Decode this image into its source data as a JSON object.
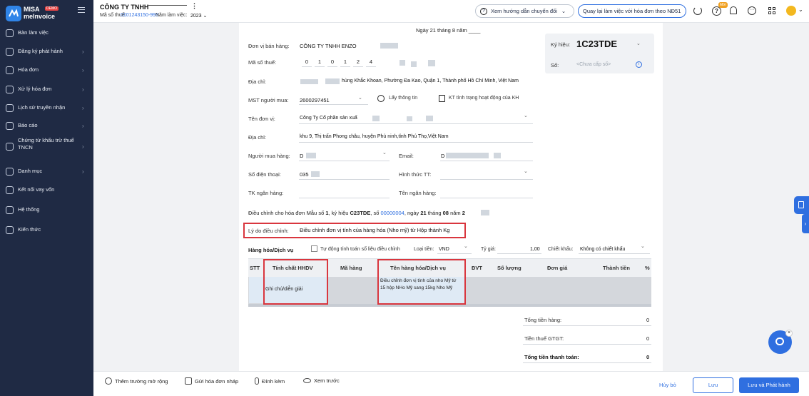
{
  "brand": {
    "line1": "MISA",
    "line2": "meInvoice",
    "badge": "DEMO"
  },
  "sidebar": {
    "items": [
      {
        "label": "Bàn làm việc",
        "icon": "desktop-icon",
        "chev": false
      },
      {
        "label": "Đăng ký phát hành",
        "icon": "register-icon",
        "chev": true
      },
      {
        "label": "Hóa đơn",
        "icon": "invoice-icon",
        "chev": true
      },
      {
        "label": "Xử lý hóa đơn",
        "icon": "process-icon",
        "chev": true
      },
      {
        "label": "Lịch sử truyền nhận",
        "icon": "transfer-icon",
        "chev": true
      },
      {
        "label": "Báo cáo",
        "icon": "report-icon",
        "chev": true
      },
      {
        "label": "Chứng từ khấu trừ thuế TNCN",
        "icon": "tax-doc-icon",
        "chev": true
      },
      {
        "label": "Danh mục",
        "icon": "catalog-icon",
        "chev": true
      },
      {
        "label": "Kết nối vay vốn",
        "icon": "loan-icon",
        "chev": false
      },
      {
        "label": "Hệ thống",
        "icon": "settings-icon",
        "chev": false
      },
      {
        "label": "Kiến thức",
        "icon": "bulb-icon",
        "chev": false
      }
    ]
  },
  "header": {
    "company": "CÔNG TY TNHH",
    "tax_label": "Mã số thuế:",
    "tax_value": "0101243150-996",
    "year_label": "Năm làm việc:",
    "year_value": "2023",
    "guide_btn": "Xem hướng dẫn chuyển đổi",
    "back_btn": "Quay lại làm việc với hóa đơn theo NĐ51",
    "new_badge": "Mới"
  },
  "invoice": {
    "date": "Ngày 21 tháng 8 năm ____",
    "symbol_label": "Ký hiệu:",
    "symbol_value": "1C23TDE",
    "number_label": "Số:",
    "number_placeholder": "<Chưa cấp số>",
    "seller_label": "Đơn vị bán hàng:",
    "seller_value": "CÔNG TY TNHH ENZO",
    "tax_label": "Mã số thuế:",
    "tax_digits": [
      "0",
      "1",
      "0",
      "1",
      "2",
      "4"
    ],
    "address_label": "Địa chỉ:",
    "address_value": "hùng Khắc Khoan, Phường Đa Kao, Quận 1, Thành phố Hồ Chí Minh, Việt Nam",
    "buyer_tax_label": "MST người mua:",
    "buyer_tax_value": "2600297451",
    "lookup_btn": "Lấy thông tin",
    "check_btn": "KT tình trạng hoạt động của KH",
    "unit_label": "Tên đơn vị:",
    "unit_value": "Công Ty Cổ phần sản xuấ",
    "address2_label": "Địa chỉ:",
    "address2_value": "khu 9, Thị trấn Phong châu, huyện Phù ninh,tỉnh Phú Thọ,Việt Nam",
    "buyer_label": "Người mua hàng:",
    "buyer_value": "D",
    "email_label": "Email:",
    "email_value": "D",
    "phone_label": "Số điện thoại:",
    "phone_value": "035",
    "payment_label": "Hình thức TT:",
    "bank_label": "TK ngân hàng:",
    "bankname_label": "Tên ngân hàng:",
    "adjust_prefix": "Điều chỉnh cho hóa đơn Mẫu số ",
    "adjust_form": "1",
    "adjust_mid": ", ký hiệu ",
    "adjust_symbol": "C23TDE",
    "adjust_mid2": ", số ",
    "adjust_number": "00000004",
    "adjust_mid3": ", ngày ",
    "adjust_day": "21",
    "adjust_mid4": " tháng ",
    "adjust_month": "08",
    "adjust_mid5": " năm ",
    "adjust_year": "2",
    "reason_label": "Lý do điều chỉnh:",
    "reason_value": "Điều chỉnh đơn vị tính của hàng hóa (Nho mỹ) từ Hộp thành Kg",
    "goods_label": "Hàng hóa/Dịch vụ",
    "auto_calc": "Tự động tính toán số liệu điều chỉnh",
    "currency_label": "Loại tiền:",
    "currency_value": "VND",
    "rate_label": "Tỷ giá:",
    "rate_value": "1,00",
    "discount_label": "Chiết khấu:",
    "discount_value": "Không có chiết khấu",
    "columns": [
      "STT",
      "Tính chất HHDV",
      "Mã hàng",
      "Tên hàng hóa/Dịch vụ",
      "ĐVT",
      "Số lượng",
      "Đơn giá",
      "Thành tiền",
      "%"
    ],
    "row": {
      "nature": "Ghi chú/diễn giải",
      "name": "Điều chỉnh đơn vị tính của nho Mỹ từ 15 hộp NHo Mỹ sang 15kg Nho Mỹ"
    },
    "totals": [
      {
        "label": "Tổng tiền hàng:",
        "value": "0"
      },
      {
        "label": "Tiền thuế GTGT:",
        "value": "0"
      },
      {
        "label": "Tổng tiền thanh toán:",
        "value": "0"
      }
    ]
  },
  "footer": {
    "extend": "Thêm trường mở rộng",
    "send_draft": "Gửi hóa đơn nháp",
    "attach": "Đính kèm",
    "preview": "Xem trước",
    "cancel": "Hủy bỏ",
    "save": "Lưu",
    "save_issue": "Lưu và Phát hành"
  }
}
